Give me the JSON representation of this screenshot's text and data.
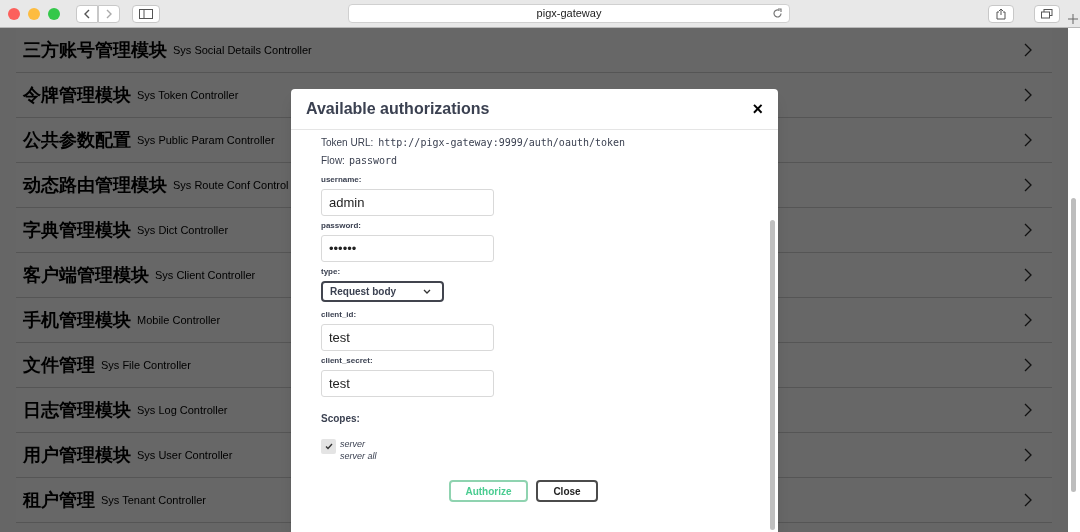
{
  "browser": {
    "address": "pigx-gateway"
  },
  "modules": [
    {
      "name": "三方账号管理模块",
      "controller": "Sys Social Details Controller"
    },
    {
      "name": "令牌管理模块",
      "controller": "Sys Token Controller"
    },
    {
      "name": "公共参数配置",
      "controller": "Sys Public Param Controller"
    },
    {
      "name": "动态路由管理模块",
      "controller": "Sys Route Conf Control"
    },
    {
      "name": "字典管理模块",
      "controller": "Sys Dict Controller"
    },
    {
      "name": "客户端管理模块",
      "controller": "Sys Client Controller"
    },
    {
      "name": "手机管理模块",
      "controller": "Mobile Controller"
    },
    {
      "name": "文件管理",
      "controller": "Sys File Controller"
    },
    {
      "name": "日志管理模块",
      "controller": "Sys Log Controller"
    },
    {
      "name": "用户管理模块",
      "controller": "Sys User Controller"
    },
    {
      "name": "租户管理",
      "controller": "Sys Tenant Controller"
    }
  ],
  "dialog": {
    "title": "Available authorizations",
    "close": "×",
    "token_url_label": "Token URL:",
    "token_url": "http://pigx-gateway:9999/auth/oauth/token",
    "flow_label": "Flow:",
    "flow": "password",
    "fields": [
      {
        "label": "username:",
        "kind": "text",
        "value": "admin"
      },
      {
        "label": "password:",
        "kind": "text",
        "value": "••••••"
      },
      {
        "label": "type:",
        "kind": "select",
        "value": "Request body"
      },
      {
        "label": "client_id:",
        "kind": "text",
        "value": "test"
      },
      {
        "label": "client_secret:",
        "kind": "text",
        "value": "test"
      }
    ],
    "scopes_label": "Scopes:",
    "scopes": [
      {
        "name": "server",
        "description": "server all",
        "checked": true
      }
    ],
    "buttons": [
      {
        "label": "Authorize",
        "kind": "primary"
      },
      {
        "label": "Close",
        "kind": "secondary"
      }
    ]
  }
}
